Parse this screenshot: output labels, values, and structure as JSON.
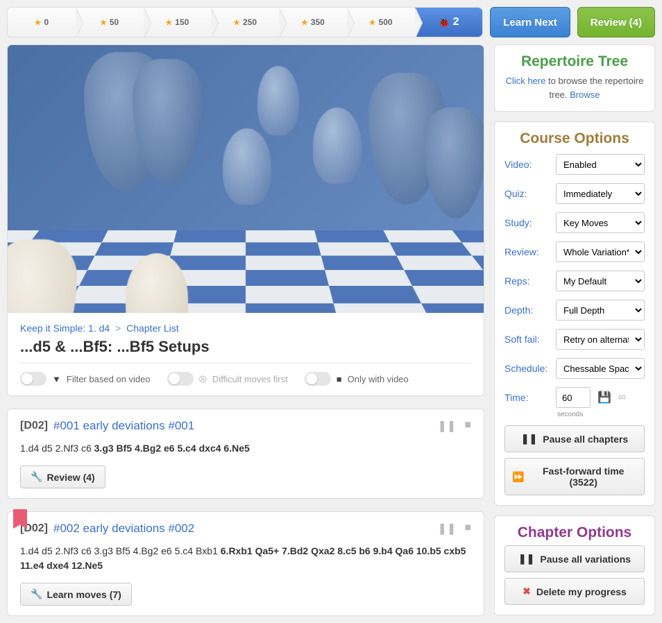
{
  "progress": {
    "steps": [
      0,
      50,
      150,
      250,
      350,
      500
    ],
    "current_count": 2
  },
  "buttons": {
    "learn_next": "Learn Next",
    "review": "Review (4)"
  },
  "breadcrumb": {
    "course": "Keep it Simple: 1. d4",
    "list": "Chapter List"
  },
  "chapter_title": "...d5 & ...Bf5: ...Bf5 Setups",
  "filters": {
    "video": "Filter based on video",
    "difficult": "Difficult moves first",
    "only_video": "Only with video"
  },
  "variations": [
    {
      "eco": "[D02]",
      "title": "#001 early deviations #001",
      "moves_plain": "1.d4 d5 2.Nf3 c6 ",
      "moves_bold": "3.g3 Bf5 4.Bg2 e6 5.c4 dxc4 6.Ne5",
      "action": "Review (4)",
      "action_icon": "wrench",
      "bookmark": false
    },
    {
      "eco": "[D02]",
      "title": "#002 early deviations #002",
      "moves_plain": "1.d4 d5 2.Nf3 c6 3.g3 Bf5 4.Bg2 e6 5.c4 Bxb1 ",
      "moves_bold": "6.Rxb1 Qa5+ 7.Bd2 Qxa2 8.c5 b6 9.b4 Qa6 10.b5 cxb5 11.e4 dxe4 12.Ne5",
      "action": "Learn moves (7)",
      "action_icon": "wrench",
      "bookmark": true
    }
  ],
  "repertoire": {
    "title": "Repertoire Tree",
    "text_prefix": "Click here",
    "text_mid": " to browse the repertoire tree. ",
    "text_suffix": "Browse"
  },
  "course_options": {
    "title": "Course Options",
    "rows": [
      {
        "label": "Video:",
        "value": "Enabled"
      },
      {
        "label": "Quiz:",
        "value": "Immediately"
      },
      {
        "label": "Study:",
        "value": "Key Moves"
      },
      {
        "label": "Review:",
        "value": "Whole Variation*"
      },
      {
        "label": "Reps:",
        "value": "My Default"
      },
      {
        "label": "Depth:",
        "value": "Full Depth"
      },
      {
        "label": "Soft fail:",
        "value": "Retry on alternat"
      },
      {
        "label": "Schedule:",
        "value": "Chessable Spac"
      }
    ],
    "time_label": "Time:",
    "time_value": "60",
    "seconds": "seconds",
    "pause_all": "Pause all chapters",
    "ff": "Fast-forward time (3522)"
  },
  "chapter_options": {
    "title": "Chapter Options",
    "pause_all": "Pause all variations",
    "delete": "Delete my progress"
  }
}
